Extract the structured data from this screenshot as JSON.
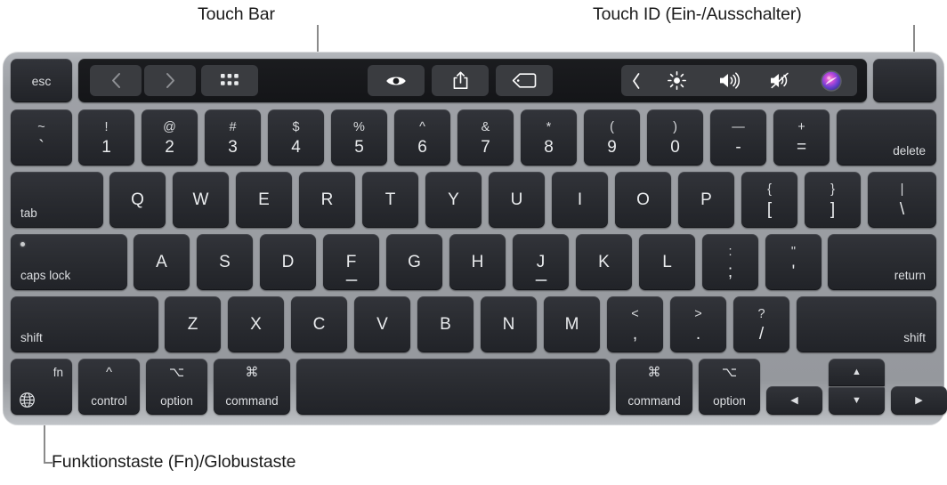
{
  "callouts": {
    "touch_bar": "Touch Bar",
    "touch_id": "Touch ID (Ein-/Ausschalter)",
    "fn_key": "Funktionstaste (Fn)/Globustaste"
  },
  "touch_bar": {
    "esc_label": "esc",
    "controls": [
      {
        "name": "back-icon",
        "icon": "chevron-left"
      },
      {
        "name": "forward-icon",
        "icon": "chevron-right"
      },
      {
        "name": "grid-view-icon",
        "icon": "grid-dots"
      },
      {
        "name": "quick-look-icon",
        "icon": "eye"
      },
      {
        "name": "share-icon",
        "icon": "share-up-arrow"
      },
      {
        "name": "tag-icon",
        "icon": "tag"
      }
    ],
    "control_strip": [
      {
        "name": "expand-control-strip-icon",
        "icon": "chevron-left-thin"
      },
      {
        "name": "brightness-icon",
        "icon": "brightness"
      },
      {
        "name": "volume-icon",
        "icon": "speaker-waves"
      },
      {
        "name": "mute-icon",
        "icon": "speaker-muted"
      },
      {
        "name": "siri-icon",
        "icon": "siri-orb"
      }
    ],
    "touch_id_label": ""
  },
  "rows": {
    "number_row": [
      {
        "name": "key-grave",
        "top": "~",
        "bot": "`"
      },
      {
        "name": "key-1",
        "top": "!",
        "bot": "1"
      },
      {
        "name": "key-2",
        "top": "@",
        "bot": "2"
      },
      {
        "name": "key-3",
        "top": "#",
        "bot": "3"
      },
      {
        "name": "key-4",
        "top": "$",
        "bot": "4"
      },
      {
        "name": "key-5",
        "top": "%",
        "bot": "5"
      },
      {
        "name": "key-6",
        "top": "^",
        "bot": "6"
      },
      {
        "name": "key-7",
        "top": "&",
        "bot": "7"
      },
      {
        "name": "key-8",
        "top": "*",
        "bot": "8"
      },
      {
        "name": "key-9",
        "top": "(",
        "bot": "9"
      },
      {
        "name": "key-0",
        "top": ")",
        "bot": "0"
      },
      {
        "name": "key-minus",
        "top": "—",
        "bot": "-"
      },
      {
        "name": "key-equals",
        "top": "+",
        "bot": "="
      }
    ],
    "delete_label": "delete",
    "tab_label": "tab",
    "qwerty_row": [
      {
        "name": "key-q",
        "label": "Q"
      },
      {
        "name": "key-w",
        "label": "W"
      },
      {
        "name": "key-e",
        "label": "E"
      },
      {
        "name": "key-r",
        "label": "R"
      },
      {
        "name": "key-t",
        "label": "T"
      },
      {
        "name": "key-y",
        "label": "Y"
      },
      {
        "name": "key-u",
        "label": "U"
      },
      {
        "name": "key-i",
        "label": "I"
      },
      {
        "name": "key-o",
        "label": "O"
      },
      {
        "name": "key-p",
        "label": "P"
      }
    ],
    "qwerty_dual": [
      {
        "name": "key-bracket-left",
        "top": "{",
        "bot": "["
      },
      {
        "name": "key-bracket-right",
        "top": "}",
        "bot": "]"
      },
      {
        "name": "key-backslash",
        "top": "|",
        "bot": "\\"
      }
    ],
    "caps_lock_label": "caps lock",
    "home_row": [
      {
        "name": "key-a",
        "label": "A"
      },
      {
        "name": "key-s",
        "label": "S"
      },
      {
        "name": "key-d",
        "label": "D"
      },
      {
        "name": "key-f",
        "label": "F"
      },
      {
        "name": "key-g",
        "label": "G"
      },
      {
        "name": "key-h",
        "label": "H"
      },
      {
        "name": "key-j",
        "label": "J"
      },
      {
        "name": "key-k",
        "label": "K"
      },
      {
        "name": "key-l",
        "label": "L"
      }
    ],
    "home_dual": [
      {
        "name": "key-semicolon",
        "top": ":",
        "bot": ";"
      },
      {
        "name": "key-quote",
        "top": "\"",
        "bot": "'"
      }
    ],
    "return_label": "return",
    "shift_left_label": "shift",
    "shift_right_label": "shift",
    "bottom_letter_row": [
      {
        "name": "key-z",
        "label": "Z"
      },
      {
        "name": "key-x",
        "label": "X"
      },
      {
        "name": "key-c",
        "label": "C"
      },
      {
        "name": "key-v",
        "label": "V"
      },
      {
        "name": "key-b",
        "label": "B"
      },
      {
        "name": "key-n",
        "label": "N"
      },
      {
        "name": "key-m",
        "label": "M"
      }
    ],
    "bottom_dual": [
      {
        "name": "key-comma",
        "top": "<",
        "bot": ","
      },
      {
        "name": "key-period",
        "top": ">",
        "bot": "."
      },
      {
        "name": "key-slash",
        "top": "?",
        "bot": "/"
      }
    ],
    "modifier_row": {
      "fn_label": "fn",
      "control_symbol": "^",
      "control_label": "control",
      "option_left_symbol": "⌥",
      "option_left_label": "option",
      "command_left_symbol": "⌘",
      "command_left_label": "command",
      "space_label": "",
      "command_right_symbol": "⌘",
      "command_right_label": "command",
      "option_right_symbol": "⌥",
      "option_right_label": "option"
    },
    "arrows": {
      "left": "◀",
      "up": "▲",
      "down": "▼",
      "right": "▶"
    }
  },
  "colors": {
    "keycap": "#2a2c31",
    "chassis": "#9a9da2",
    "legend": "#e9ebed",
    "touchbar_bg": "#171819",
    "touchbar_btn": "#3a3c40",
    "page_bg": "#ffffff",
    "caption": "#1a1a1a",
    "leader_line": "#8a8a8a"
  }
}
